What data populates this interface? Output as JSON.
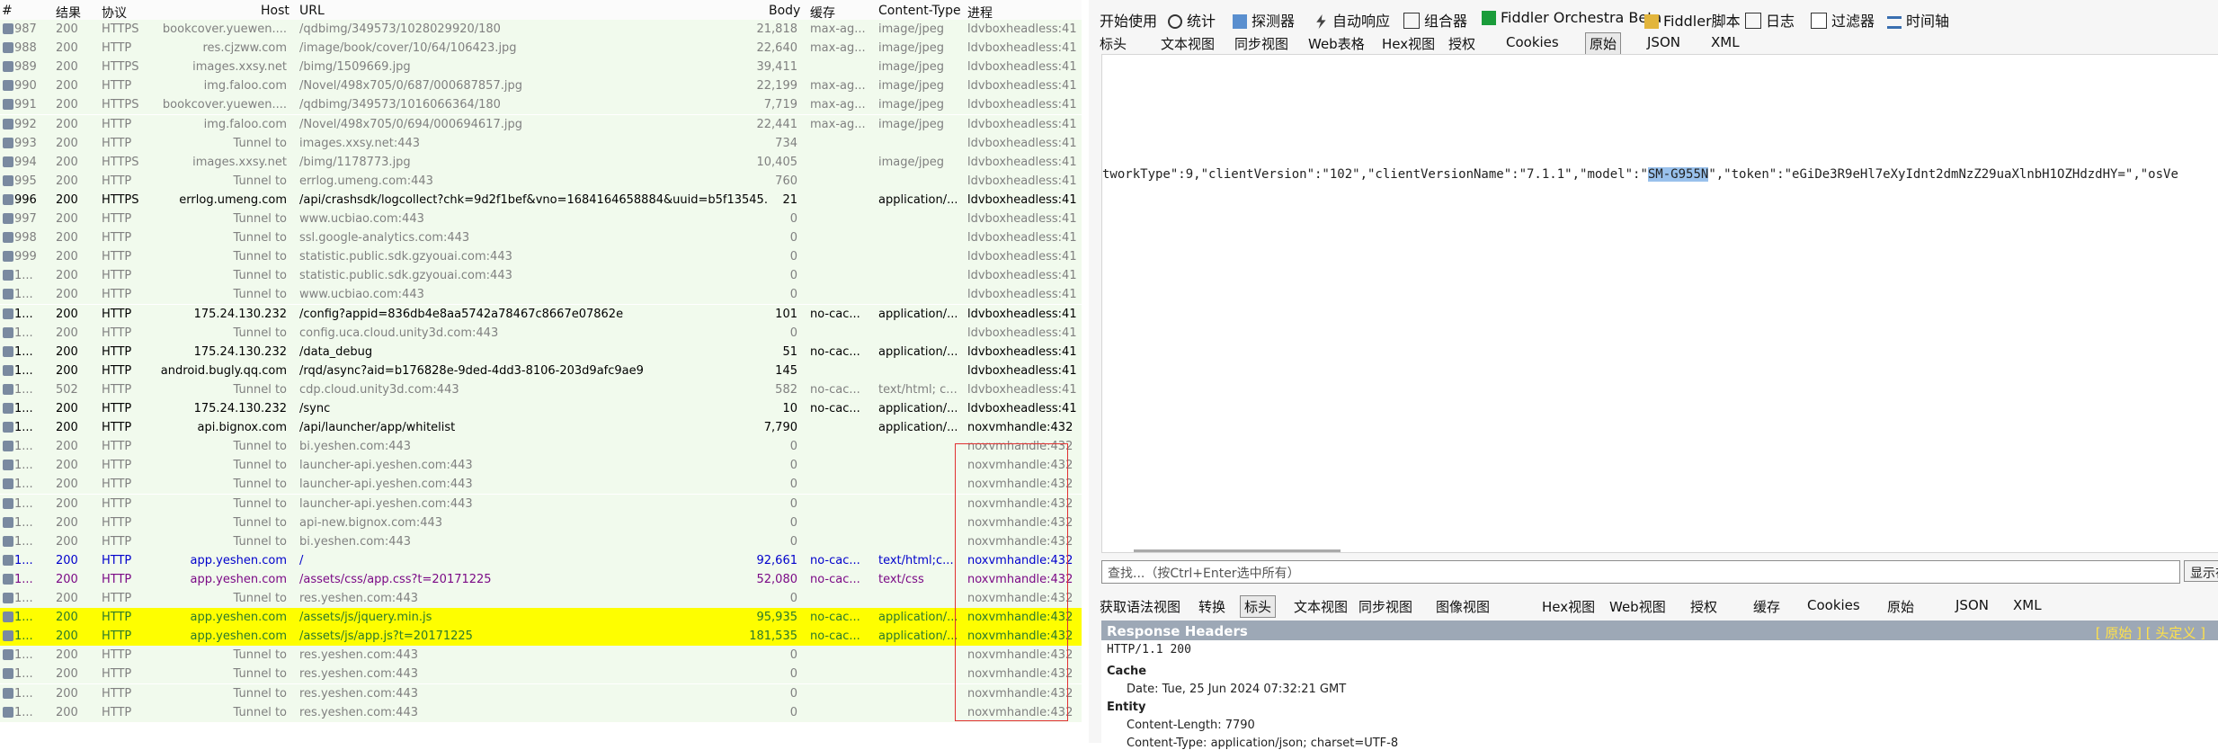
{
  "columns": {
    "num": "#",
    "result": "结果",
    "protocol": "协议",
    "host": "Host",
    "url": "URL",
    "body": "Body",
    "cache": "缓存",
    "ctype": "Content-Type",
    "process": "进程"
  },
  "sessions": [
    {
      "num": "987",
      "result": "200",
      "protocol": "HTTPS",
      "host": "bookcover.yuewen....",
      "url": "/qdbimg/349573/1028029920/180",
      "body": "21,818",
      "cache": "max-ag...",
      "ctype": "image/jpeg",
      "process": "ldvboxheadless:41",
      "style": "grey",
      "hl": false
    },
    {
      "num": "988",
      "result": "200",
      "protocol": "HTTP",
      "host": "res.cjzww.com",
      "url": "/image/book/cover/10/64/106423.jpg",
      "body": "22,640",
      "cache": "max-ag...",
      "ctype": "image/jpeg",
      "process": "ldvboxheadless:41",
      "style": "grey",
      "hl": false
    },
    {
      "num": "989",
      "result": "200",
      "protocol": "HTTPS",
      "host": "images.xxsy.net",
      "url": "/bimg/1509669.jpg",
      "body": "39,411",
      "cache": "",
      "ctype": "image/jpeg",
      "process": "ldvboxheadless:41",
      "style": "grey",
      "hl": false
    },
    {
      "num": "990",
      "result": "200",
      "protocol": "HTTP",
      "host": "img.faloo.com",
      "url": "/Novel/498x705/0/687/000687857.jpg",
      "body": "22,199",
      "cache": "max-ag...",
      "ctype": "image/jpeg",
      "process": "ldvboxheadless:41",
      "style": "grey",
      "hl": false
    },
    {
      "num": "991",
      "result": "200",
      "protocol": "HTTPS",
      "host": "bookcover.yuewen....",
      "url": "/qdbimg/349573/1016066364/180",
      "body": "7,719",
      "cache": "max-ag...",
      "ctype": "image/jpeg",
      "process": "ldvboxheadless:41",
      "style": "grey",
      "hl": false
    },
    {
      "num": "992",
      "result": "200",
      "protocol": "HTTP",
      "host": "img.faloo.com",
      "url": "/Novel/498x705/0/694/000694617.jpg",
      "body": "22,441",
      "cache": "max-ag...",
      "ctype": "image/jpeg",
      "process": "ldvboxheadless:41",
      "style": "grey",
      "hl": false
    },
    {
      "num": "993",
      "result": "200",
      "protocol": "HTTP",
      "host": "Tunnel to",
      "url": "images.xxsy.net:443",
      "body": "734",
      "cache": "",
      "ctype": "",
      "process": "ldvboxheadless:41",
      "style": "grey",
      "hl": false
    },
    {
      "num": "994",
      "result": "200",
      "protocol": "HTTPS",
      "host": "images.xxsy.net",
      "url": "/bimg/1178773.jpg",
      "body": "10,405",
      "cache": "",
      "ctype": "image/jpeg",
      "process": "ldvboxheadless:41",
      "style": "grey",
      "hl": false
    },
    {
      "num": "995",
      "result": "200",
      "protocol": "HTTP",
      "host": "Tunnel to",
      "url": "errlog.umeng.com:443",
      "body": "760",
      "cache": "",
      "ctype": "",
      "process": "ldvboxheadless:41",
      "style": "grey",
      "hl": false
    },
    {
      "num": "996",
      "result": "200",
      "protocol": "HTTPS",
      "host": "errlog.umeng.com",
      "url": "/api/crashsdk/logcollect?chk=9d2f1bef&vno=1684164658884&uuid=b5f13545...",
      "body": "21",
      "cache": "",
      "ctype": "application/...",
      "process": "ldvboxheadless:41",
      "style": "black",
      "hl": false
    },
    {
      "num": "997",
      "result": "200",
      "protocol": "HTTP",
      "host": "Tunnel to",
      "url": "www.ucbiao.com:443",
      "body": "0",
      "cache": "",
      "ctype": "",
      "process": "ldvboxheadless:41",
      "style": "grey",
      "hl": false
    },
    {
      "num": "998",
      "result": "200",
      "protocol": "HTTP",
      "host": "Tunnel to",
      "url": "ssl.google-analytics.com:443",
      "body": "0",
      "cache": "",
      "ctype": "",
      "process": "ldvboxheadless:41",
      "style": "grey",
      "hl": false
    },
    {
      "num": "999",
      "result": "200",
      "protocol": "HTTP",
      "host": "Tunnel to",
      "url": "statistic.public.sdk.gzyouai.com:443",
      "body": "0",
      "cache": "",
      "ctype": "",
      "process": "ldvboxheadless:41",
      "style": "grey",
      "hl": false
    },
    {
      "num": "1...",
      "result": "200",
      "protocol": "HTTP",
      "host": "Tunnel to",
      "url": "statistic.public.sdk.gzyouai.com:443",
      "body": "0",
      "cache": "",
      "ctype": "",
      "process": "ldvboxheadless:41",
      "style": "grey",
      "hl": false
    },
    {
      "num": "1...",
      "result": "200",
      "protocol": "HTTP",
      "host": "Tunnel to",
      "url": "www.ucbiao.com:443",
      "body": "0",
      "cache": "",
      "ctype": "",
      "process": "ldvboxheadless:41",
      "style": "grey",
      "hl": false
    },
    {
      "num": "1...",
      "result": "200",
      "protocol": "HTTP",
      "host": "175.24.130.232",
      "url": "/config?appid=836db4e8aa5742a78467c8667e07862e",
      "body": "101",
      "cache": "no-cac...",
      "ctype": "application/...",
      "process": "ldvboxheadless:41",
      "style": "black",
      "hl": false
    },
    {
      "num": "1...",
      "result": "200",
      "protocol": "HTTP",
      "host": "Tunnel to",
      "url": "config.uca.cloud.unity3d.com:443",
      "body": "0",
      "cache": "",
      "ctype": "",
      "process": "ldvboxheadless:41",
      "style": "grey",
      "hl": false
    },
    {
      "num": "1...",
      "result": "200",
      "protocol": "HTTP",
      "host": "175.24.130.232",
      "url": "/data_debug",
      "body": "51",
      "cache": "no-cac...",
      "ctype": "application/...",
      "process": "ldvboxheadless:41",
      "style": "black",
      "hl": false
    },
    {
      "num": "1...",
      "result": "200",
      "protocol": "HTTP",
      "host": "android.bugly.qq.com",
      "url": "/rqd/async?aid=b176828e-9ded-4dd3-8106-203d9afc9ae9",
      "body": "145",
      "cache": "",
      "ctype": "",
      "process": "ldvboxheadless:41",
      "style": "black",
      "hl": false
    },
    {
      "num": "1...",
      "result": "502",
      "protocol": "HTTP",
      "host": "Tunnel to",
      "url": "cdp.cloud.unity3d.com:443",
      "body": "582",
      "cache": "no-cac...",
      "ctype": "text/html; c...",
      "process": "ldvboxheadless:41",
      "style": "grey",
      "hl": false
    },
    {
      "num": "1...",
      "result": "200",
      "protocol": "HTTP",
      "host": "175.24.130.232",
      "url": "/sync",
      "body": "10",
      "cache": "no-cac...",
      "ctype": "application/...",
      "process": "ldvboxheadless:41",
      "style": "black",
      "hl": false
    },
    {
      "num": "1...",
      "result": "200",
      "protocol": "HTTP",
      "host": "api.bignox.com",
      "url": "/api/launcher/app/whitelist",
      "body": "7,790",
      "cache": "",
      "ctype": "application/...",
      "process": "noxvmhandle:432",
      "style": "black",
      "hl": false
    },
    {
      "num": "1...",
      "result": "200",
      "protocol": "HTTP",
      "host": "Tunnel to",
      "url": "bi.yeshen.com:443",
      "body": "0",
      "cache": "",
      "ctype": "",
      "process": "noxvmhandle:432",
      "style": "grey",
      "hl": false
    },
    {
      "num": "1...",
      "result": "200",
      "protocol": "HTTP",
      "host": "Tunnel to",
      "url": "launcher-api.yeshen.com:443",
      "body": "0",
      "cache": "",
      "ctype": "",
      "process": "noxvmhandle:432",
      "style": "grey",
      "hl": false
    },
    {
      "num": "1...",
      "result": "200",
      "protocol": "HTTP",
      "host": "Tunnel to",
      "url": "launcher-api.yeshen.com:443",
      "body": "0",
      "cache": "",
      "ctype": "",
      "process": "noxvmhandle:432",
      "style": "grey",
      "hl": false
    },
    {
      "num": "1...",
      "result": "200",
      "protocol": "HTTP",
      "host": "Tunnel to",
      "url": "launcher-api.yeshen.com:443",
      "body": "0",
      "cache": "",
      "ctype": "",
      "process": "noxvmhandle:432",
      "style": "grey",
      "hl": false
    },
    {
      "num": "1...",
      "result": "200",
      "protocol": "HTTP",
      "host": "Tunnel to",
      "url": "api-new.bignox.com:443",
      "body": "0",
      "cache": "",
      "ctype": "",
      "process": "noxvmhandle:432",
      "style": "grey",
      "hl": false
    },
    {
      "num": "1...",
      "result": "200",
      "protocol": "HTTP",
      "host": "Tunnel to",
      "url": "bi.yeshen.com:443",
      "body": "0",
      "cache": "",
      "ctype": "",
      "process": "noxvmhandle:432",
      "style": "grey",
      "hl": false
    },
    {
      "num": "1...",
      "result": "200",
      "protocol": "HTTP",
      "host": "app.yeshen.com",
      "url": "/",
      "body": "92,661",
      "cache": "no-cac...",
      "ctype": "text/html;c...",
      "process": "noxvmhandle:432",
      "style": "blue",
      "hl": false
    },
    {
      "num": "1...",
      "result": "200",
      "protocol": "HTTP",
      "host": "app.yeshen.com",
      "url": "/assets/css/app.css?t=20171225",
      "body": "52,080",
      "cache": "no-cac...",
      "ctype": "text/css",
      "process": "noxvmhandle:432",
      "style": "purple",
      "hl": false
    },
    {
      "num": "1...",
      "result": "200",
      "protocol": "HTTP",
      "host": "Tunnel to",
      "url": "res.yeshen.com:443",
      "body": "0",
      "cache": "",
      "ctype": "",
      "process": "noxvmhandle:432",
      "style": "grey",
      "hl": false
    },
    {
      "num": "1...",
      "result": "200",
      "protocol": "HTTP",
      "host": "app.yeshen.com",
      "url": "/assets/js/jquery.min.js",
      "body": "95,935",
      "cache": "no-cac...",
      "ctype": "application/...",
      "process": "noxvmhandle:432",
      "style": "grn",
      "hl": true
    },
    {
      "num": "1...",
      "result": "200",
      "protocol": "HTTP",
      "host": "app.yeshen.com",
      "url": "/assets/js/app.js?t=20171225",
      "body": "181,535",
      "cache": "no-cac...",
      "ctype": "application/...",
      "process": "noxvmhandle:432",
      "style": "grn",
      "hl": true
    },
    {
      "num": "1...",
      "result": "200",
      "protocol": "HTTP",
      "host": "Tunnel to",
      "url": "res.yeshen.com:443",
      "body": "0",
      "cache": "",
      "ctype": "",
      "process": "noxvmhandle:432",
      "style": "grey",
      "hl": false
    },
    {
      "num": "1...",
      "result": "200",
      "protocol": "HTTP",
      "host": "Tunnel to",
      "url": "res.yeshen.com:443",
      "body": "0",
      "cache": "",
      "ctype": "",
      "process": "noxvmhandle:432",
      "style": "grey",
      "hl": false
    },
    {
      "num": "1...",
      "result": "200",
      "protocol": "HTTP",
      "host": "Tunnel to",
      "url": "res.yeshen.com:443",
      "body": "0",
      "cache": "",
      "ctype": "",
      "process": "noxvmhandle:432",
      "style": "grey",
      "hl": false
    },
    {
      "num": "1...",
      "result": "200",
      "protocol": "HTTP",
      "host": "Tunnel to",
      "url": "res.yeshen.com:443",
      "body": "0",
      "cache": "",
      "ctype": "",
      "process": "noxvmhandle:432",
      "style": "grey",
      "hl": false
    }
  ],
  "toolbar": {
    "start": "开始使用",
    "stats": "统计",
    "inspector": "探测器",
    "autoresponder": "自动响应",
    "composer": "组合器",
    "orchestra": "Fiddler Orchestra Beta",
    "script": "Fiddler脚本",
    "log": "日志",
    "filters": "过滤器",
    "timeline": "时间轴"
  },
  "req_tabs": [
    "标头",
    "文本视图",
    "同步视图",
    "Web表格",
    "Hex视图",
    "授权",
    "Cookies",
    "原始",
    "JSON",
    "XML"
  ],
  "req_text": {
    "before": "tworkType\":9,\"clientVersion\":\"102\",\"clientVersionName\":\"7.1.1\",\"model\":\"",
    "selected": "SM-G955N",
    "after": "\",\"token\":\"eGiDe3R9eHl7eXyIdnt2dmNzZ29uaXlnbH1OZHdzdHY=\",\"osVe"
  },
  "find": {
    "placeholder": "查找...（按Ctrl+Enter选中所有）",
    "button": "显示在"
  },
  "resp_tabs": [
    "获取语法视图",
    "转换",
    "标头",
    "文本视图",
    "同步视图",
    "图像视图",
    "Hex视图",
    "Web视图",
    "授权",
    "缓存",
    "Cookies",
    "原始",
    "JSON",
    "XML"
  ],
  "resp_headers": {
    "title": "Response Headers",
    "links": "[ 原始 ] [ 头定义 ]",
    "status": "HTTP/1.1 200",
    "cache_label": "Cache",
    "date": "Date: Tue, 25 Jun 2024 07:32:21 GMT",
    "entity_label": "Entity",
    "content_length": "Content-Length: 7790",
    "content_type": "Content-Type: application/json; charset=UTF-8"
  }
}
